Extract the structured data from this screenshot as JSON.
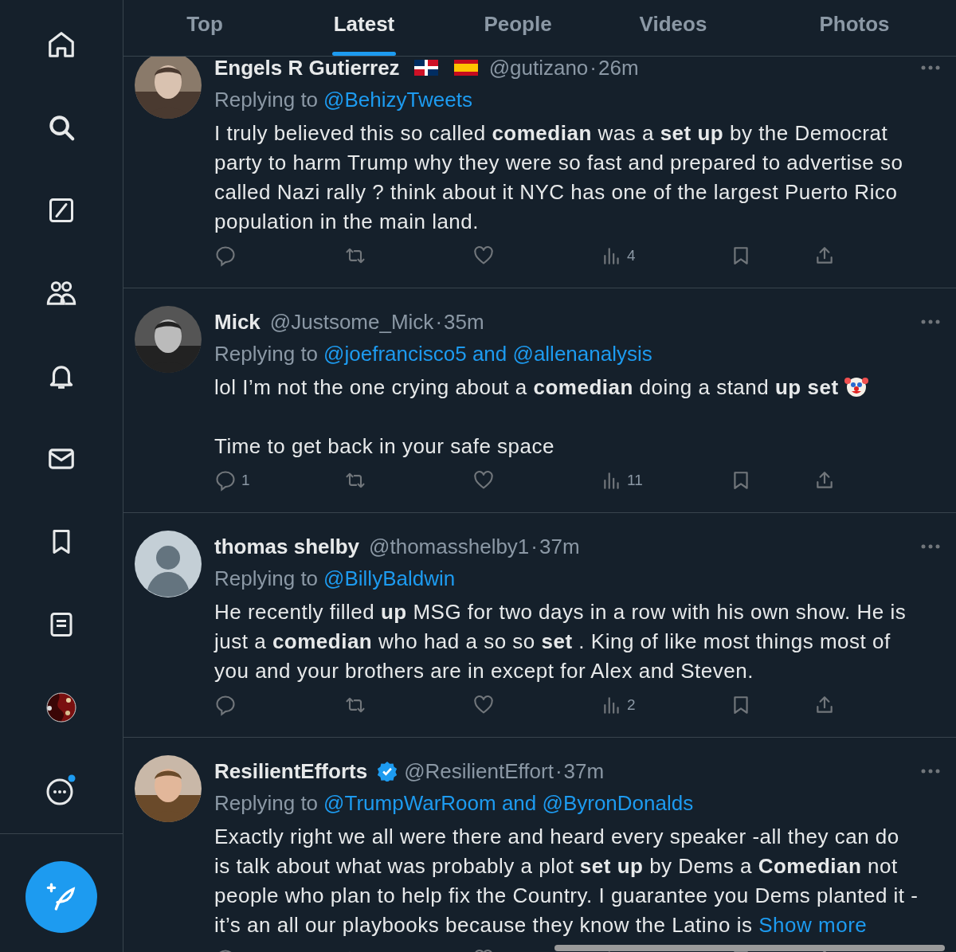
{
  "sidebar": {
    "items": [
      {
        "kind": "home",
        "selected": false
      },
      {
        "kind": "search",
        "selected": false
      },
      {
        "kind": "grok",
        "selected": false
      },
      {
        "kind": "communities",
        "selected": false
      },
      {
        "kind": "notifications",
        "selected": false
      },
      {
        "kind": "messages",
        "selected": false
      },
      {
        "kind": "bookmarks",
        "selected": false
      },
      {
        "kind": "lists",
        "selected": false
      },
      {
        "kind": "profile",
        "selected": false
      },
      {
        "kind": "more",
        "selected": false,
        "notification_dot": true
      }
    ],
    "compose_button": {
      "kind": "compose"
    }
  },
  "tabs": [
    {
      "label": "Top",
      "selected": false
    },
    {
      "label": "Latest",
      "selected": true
    },
    {
      "label": "People",
      "selected": false
    },
    {
      "label": "Videos",
      "selected": false
    },
    {
      "label": "Photos",
      "selected": false
    }
  ],
  "tweets": [
    {
      "avatar": {
        "kind": "picture"
      },
      "name": "Engels R Gutierrez",
      "flags": [
        {
          "kind": "dominican"
        },
        {
          "kind": "spanish"
        }
      ],
      "verified": false,
      "handle": "@gutizano",
      "separator": "·",
      "time": "26m",
      "replying_label": "Replying to",
      "replying_to": "@BehizyTweets",
      "paragraphs": [
        "I truly believed this so called **comedian** was a **set up** by the Democrat party to harm Trump why they were so fast and prepared to advertise so called Nazi rally ? think about it NYC has one of the largest Puerto Rico population in the main land."
      ],
      "views": "4"
    },
    {
      "avatar": {
        "kind": "picture"
      },
      "name": "Mick",
      "verified": false,
      "handle": "@Justsome_Mick",
      "separator": "·",
      "time": "35m",
      "replying_label": "Replying to",
      "replying_to": "@joefrancisco5 and @allenanalysis",
      "paragraphs": [
        "lol I’m not the one crying about a **comedian** doing a stand **up set**",
        "Time to get back in your safe space"
      ],
      "emoji": {
        "kind": "clown"
      },
      "replies": "1",
      "views": "11"
    },
    {
      "avatar": {
        "kind": "default"
      },
      "name": "thomas shelby",
      "verified": false,
      "handle": "@thomasshelby1",
      "separator": "·",
      "time": "37m",
      "replying_label": "Replying to",
      "replying_to": "@BillyBaldwin",
      "paragraphs": [
        "He recently filled **up** MSG for two days in a row with his own show. He is just a **comedian** who had a so so **set** . King of like most things most of you and your brothers are in except for Alex and Steven."
      ],
      "views": "2"
    },
    {
      "avatar": {
        "kind": "picture"
      },
      "name": "ResilientEfforts",
      "verified": true,
      "handle": "@ResilientEffort",
      "separator": "·",
      "time": "37m",
      "replying_label": "Replying to",
      "replying_to": "@TrumpWarRoom and @ByronDonalds",
      "paragraphs": [
        "Exactly right we all were there and heard every speaker -all they can do is talk about what was probably a plot **set up** by Dems a **Comedian** not people who plan to help fix the Country.  I guarantee you Dems planted it - it’s an all our playbooks because they know the Latino is"
      ],
      "show_more": "Show more"
    }
  ]
}
